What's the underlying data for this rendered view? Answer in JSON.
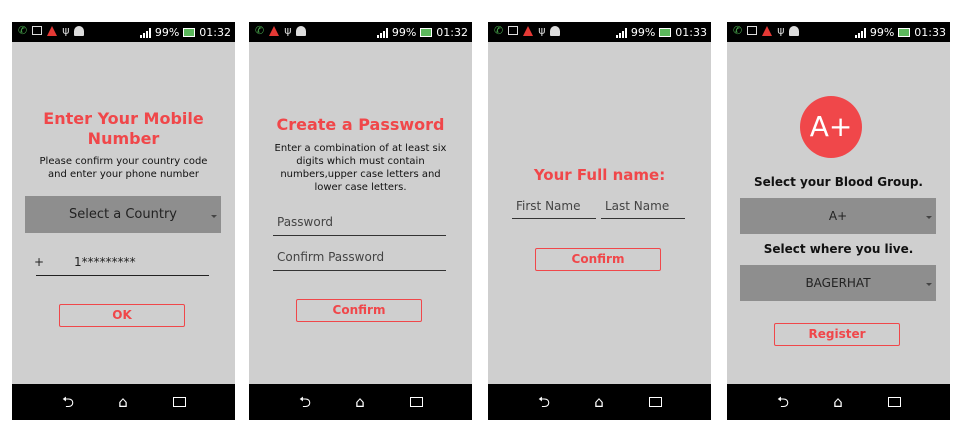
{
  "screens": [
    {
      "status_time": "01:32",
      "status_battery": "99%",
      "title": "Enter Your Mobile Number",
      "description": "Please confirm your country code and enter your phone number",
      "country_select": "Select a Country",
      "phone_prefix": "+",
      "phone_value": "1*********",
      "button": "OK"
    },
    {
      "status_time": "01:32",
      "status_battery": "99%",
      "title": "Create a Password",
      "description": "Enter a combination of at least six digits which must contain numbers,upper case letters and lower case letters.",
      "password_placeholder": "Password",
      "confirm_placeholder": "Confirm Password",
      "button": "Confirm"
    },
    {
      "status_time": "01:33",
      "status_battery": "99%",
      "title": "Your Full name:",
      "first_name_placeholder": "First Name",
      "last_name_placeholder": "Last Name",
      "button": "Confirm"
    },
    {
      "status_time": "01:33",
      "status_battery": "99%",
      "badge": "A+",
      "blood_group_label": "Select your Blood Group.",
      "blood_group_value": "A+",
      "location_label": "Select where you live.",
      "location_value": "BAGERHAT",
      "button": "Register"
    }
  ],
  "nav": {
    "back_glyph": "⮌",
    "home_glyph": "⌂"
  },
  "colors": {
    "accent": "#f0474a",
    "screen_bg": "#cfcfcf",
    "select_bg": "#8e8e8e"
  }
}
